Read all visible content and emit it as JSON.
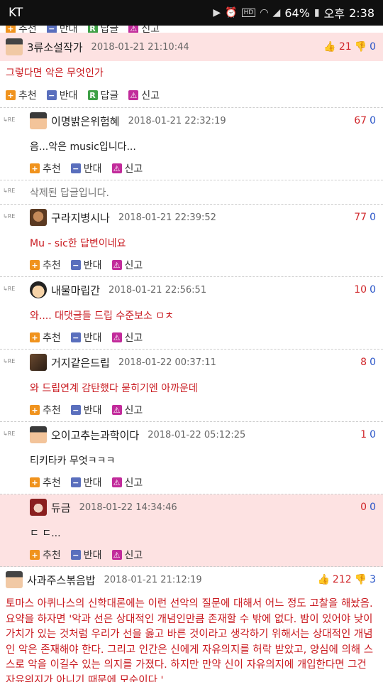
{
  "status": {
    "carrier": "KT",
    "battery": "64%",
    "ampm": "오후",
    "time": "2:38"
  },
  "labels": {
    "recommend": "추천",
    "oppose": "반대",
    "reply": "답글",
    "report": "신고",
    "re": "RE"
  },
  "comments": [
    {
      "nick": "3류소설작가",
      "date": "2018-01-21 21:10:44",
      "up": "21",
      "down": "0",
      "body": "그렇다면 악은 무엇인가"
    },
    {
      "nick": "이명밝은위험혜",
      "date": "2018-01-21 22:32:19",
      "up": "67",
      "down": "0",
      "body": "음...악은 music입니다..."
    },
    {
      "deleted": "삭제된 답글입니다."
    },
    {
      "nick": "구라지병시나",
      "date": "2018-01-21 22:39:52",
      "up": "77",
      "down": "0",
      "body": "Mu - sic한 답변이네요"
    },
    {
      "nick": "내물마립간",
      "date": "2018-01-21 22:56:51",
      "up": "10",
      "down": "0",
      "body": "와.... 대댓글들 드립 수준보소 ㅁㅊ"
    },
    {
      "nick": "거지같은드립",
      "date": "2018-01-22 00:37:11",
      "up": "8",
      "down": "0",
      "body": "와 드립연계 감탄했다 묻히기엔 아까운데"
    },
    {
      "nick": "오이고추는과학이다",
      "date": "2018-01-22 05:12:25",
      "up": "1",
      "down": "0",
      "body": "티키타카 무엇ㅋㅋㅋ"
    },
    {
      "nick": "듀금",
      "date": "2018-01-22 14:34:46",
      "up": "0",
      "down": "0",
      "body": "ㄷ ㄷ..."
    },
    {
      "nick": "사과주스볶음밥",
      "date": "2018-01-21 21:12:19",
      "up": "212",
      "down": "3",
      "body": "토마스 아퀴나스의 신학대론에는 이런 선악의 질문에 대해서 어느 정도 고찰을 해놨음. 요약을 하자면 '악과 선은 상대적인 개념인만큼 존재할 수 밖에 없다. 밤이 있어야 낮이 가치가 있는 것처럼 우리가 선을 옳고 바른 것이라고 생각하기 위해서는 상대적인 개념인 악은 존재해야 한다. 그리고 인간은 신에게 자유의지를 허락 받았고, 양심에 의해 스스로 악을 이길수 있는 의지를 가졌다. 하지만 만약 신이 자유의지에 개입한다면 그건 자유의지가 아니기 때문에 모순이다.'"
    }
  ],
  "colors": {
    "accent_red": "#c9191f",
    "up_red": "#d0262a",
    "down_blue": "#2a55c8",
    "pink_bg": "#fde2e2"
  }
}
